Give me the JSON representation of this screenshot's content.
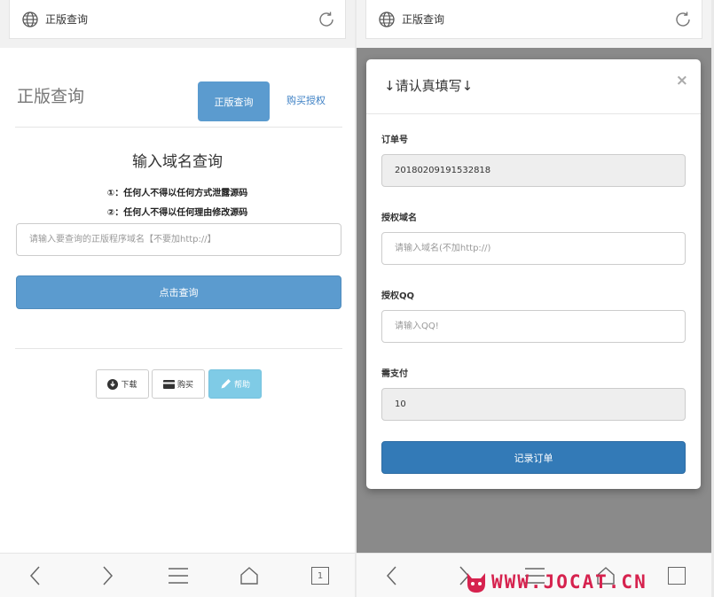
{
  "left_screen": {
    "url_title": "正版查询",
    "page_title": "正版查询",
    "tab_active": "正版查询",
    "tab_link": "购买授权",
    "heading": "输入域名查询",
    "rule1": "①：任何人不得以任何方式泄露源码",
    "rule2": "②：任何人不得以任何理由修改源码",
    "domain_placeholder": "请输入要查询的正版程序域名【不要加http://】",
    "query_button": "点击查询",
    "buttons": {
      "download": "下载",
      "buy": "购买",
      "help": "帮助"
    },
    "nav": {
      "page_count": "1"
    }
  },
  "right_screen": {
    "url_title": "正版查询",
    "modal": {
      "title": "↓请认真填写↓",
      "close": "×",
      "order_label": "订单号",
      "order_value": "20180209191532818",
      "domain_label": "授权域名",
      "domain_placeholder": "请输入域名(不加http://)",
      "qq_label": "授权QQ",
      "qq_placeholder": "请输入QQ!",
      "pay_label": "需支付",
      "pay_value": "10",
      "submit": "记录订单"
    }
  },
  "watermark": {
    "text": "WWW.JOCAT.CN"
  },
  "colors": {
    "primary": "#5b9bcf",
    "primary_dark": "#337ab7",
    "info": "#7fcbe6",
    "link": "#3b7fc4"
  }
}
